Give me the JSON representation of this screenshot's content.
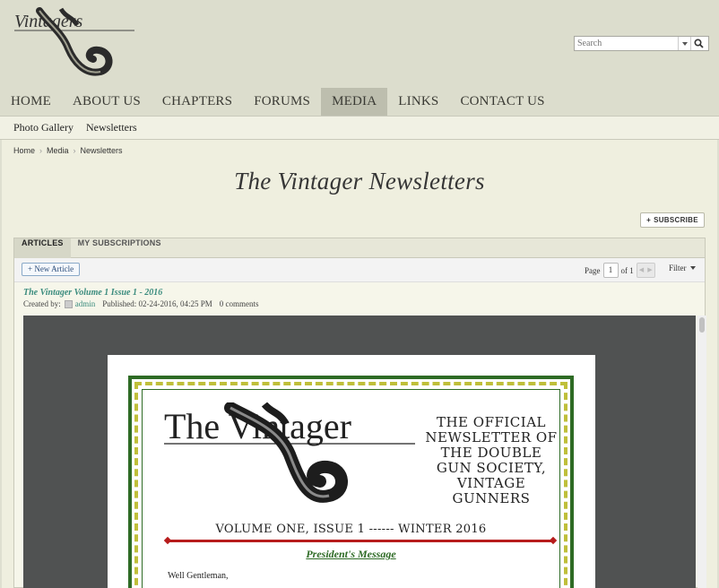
{
  "header": {
    "logo_text": "Vintagers",
    "search": {
      "placeholder": "Search"
    }
  },
  "nav": {
    "items": [
      {
        "label": "HOME"
      },
      {
        "label": "ABOUT US"
      },
      {
        "label": "CHAPTERS"
      },
      {
        "label": "FORUMS"
      },
      {
        "label": "MEDIA",
        "active": true
      },
      {
        "label": "LINKS"
      },
      {
        "label": "CONTACT US"
      }
    ]
  },
  "subnav": {
    "items": [
      {
        "label": "Photo Gallery"
      },
      {
        "label": "Newsletters"
      }
    ]
  },
  "breadcrumb": {
    "items": [
      "Home",
      "Media",
      "Newsletters"
    ]
  },
  "page": {
    "title": "The Vintager Newsletters",
    "subscribe_label": "SUBSCRIBE"
  },
  "tabs": [
    {
      "label": "ARTICLES",
      "active": true
    },
    {
      "label": "MY SUBSCRIPTIONS"
    }
  ],
  "toolbar": {
    "new_article_label": "+ New Article",
    "page_label": "Page",
    "page_value": "1",
    "of_label": "of 1",
    "filter_label": "Filter"
  },
  "article": {
    "title": "The Vintager Volume 1 Issue 1 - 2016",
    "created_by_label": "Created by:",
    "author": "admin",
    "published": "Published: 02-24-2016, 04:25 PM",
    "comments": "0 comments"
  },
  "newsletter": {
    "logo_text": "The Vintager",
    "official_lines": [
      "THE OFFICIAL",
      "NEWSLETTER OF",
      "THE DOUBLE",
      "GUN SOCIETY,",
      "VINTAGE",
      "GUNNERS"
    ],
    "volume": "VOLUME ONE, ISSUE 1 ------ WINTER 2016",
    "presidents_message": "President's Message",
    "salutation": "Well Gentleman,"
  },
  "colors": {
    "accent_link": "#3b8c7e",
    "border_green": "#2e6b25",
    "rule_red": "#b71c1c"
  }
}
